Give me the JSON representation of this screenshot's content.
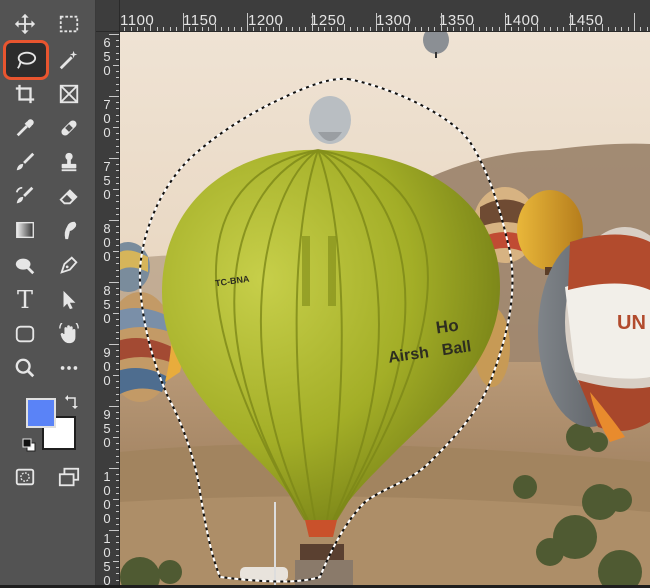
{
  "toolbar": {
    "tools": [
      {
        "name": "move-tool",
        "icon": "move-icon"
      },
      {
        "name": "marquee-tool",
        "icon": "rect-marquee-icon"
      },
      {
        "name": "lasso-tool",
        "icon": "lasso-icon",
        "active": true
      },
      {
        "name": "magic-wand-tool",
        "icon": "magic-wand-icon"
      },
      {
        "name": "crop-tool",
        "icon": "crop-icon"
      },
      {
        "name": "frame-tool",
        "icon": "frame-icon"
      },
      {
        "name": "eyedropper-tool",
        "icon": "eyedropper-icon"
      },
      {
        "name": "healing-brush-tool",
        "icon": "bandage-icon"
      },
      {
        "name": "brush-tool",
        "icon": "brush-icon"
      },
      {
        "name": "clone-stamp-tool",
        "icon": "stamp-icon"
      },
      {
        "name": "history-brush-tool",
        "icon": "history-brush-icon"
      },
      {
        "name": "eraser-tool",
        "icon": "eraser-icon"
      },
      {
        "name": "gradient-tool",
        "icon": "gradient-icon"
      },
      {
        "name": "smudge-tool",
        "icon": "smudge-icon"
      },
      {
        "name": "dodge-tool",
        "icon": "dodge-icon"
      },
      {
        "name": "pen-tool",
        "icon": "pen-icon"
      },
      {
        "name": "type-tool",
        "icon": "type-icon"
      },
      {
        "name": "path-selection-tool",
        "icon": "arrow-icon"
      },
      {
        "name": "shape-tool",
        "icon": "rounded-rect-icon"
      },
      {
        "name": "rotate-view-tool",
        "icon": "hand-icon"
      },
      {
        "name": "zoom-tool",
        "icon": "zoom-icon"
      },
      {
        "name": "more-tools",
        "icon": "more-icon"
      }
    ],
    "foreground_color": "#5a83f7",
    "background_color": "#ffffff",
    "type_tool_label": "T"
  },
  "ruler_top": {
    "labels": [
      "1100",
      "1150",
      "1200",
      "1250",
      "1300",
      "1350",
      "1400",
      "1450"
    ]
  },
  "ruler_left": {
    "labels": [
      [
        "6",
        "5",
        "0"
      ],
      [
        "7",
        "0",
        "0"
      ],
      [
        "7",
        "5",
        "0"
      ],
      [
        "8",
        "0",
        "0"
      ],
      [
        "8",
        "5",
        "0"
      ],
      [
        "9",
        "0",
        "0"
      ],
      [
        "9",
        "5",
        "0"
      ],
      [
        "1",
        "0",
        "0",
        "0"
      ],
      [
        "1",
        "0",
        "5",
        "0"
      ]
    ]
  },
  "canvas": {
    "balloon_code": "TC-BNA",
    "balloon_text_line1": "Ho",
    "balloon_text_line2": "Airsh   Ball",
    "red_balloon_text": "UN"
  },
  "colors": {
    "active_tool_outline": "#e8552f",
    "balloon_green": "#a4b12c",
    "sky": "#efe3d3"
  }
}
